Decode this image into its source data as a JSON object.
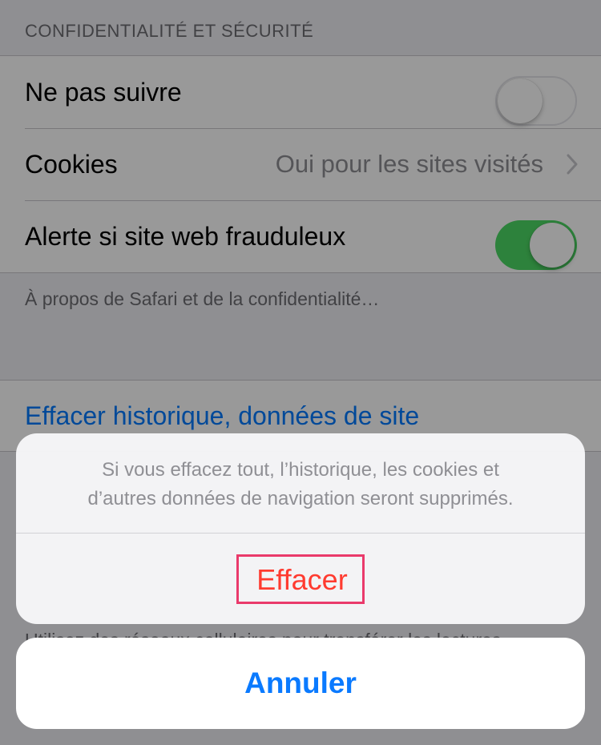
{
  "section": {
    "header": "CONFIDENTIALITÉ ET SÉCURITÉ"
  },
  "privacy_cells": [
    {
      "label": "Ne pas suivre",
      "control": "switch",
      "state": "off"
    },
    {
      "label": "Cookies",
      "value": "Oui pour les sites visités",
      "control": "chevron"
    },
    {
      "label": "Alerte si site web frauduleux",
      "control": "switch",
      "state": "on"
    }
  ],
  "footer_note": "À propos de Safari et de la confidentialité…",
  "clear_history": {
    "label": "Effacer historique, données de site"
  },
  "background_footer_text": "Utilisez des réseaux cellulaires pour transférer les lectures",
  "action_sheet": {
    "message_line1": "Si vous effacez tout, l’historique, les cookies et",
    "message_line2": "d’autres données de navigation seront supprimés.",
    "destructive_label": "Effacer",
    "cancel_label": "Annuler"
  },
  "colors": {
    "switch_on": "#4cd964",
    "link": "#007aff",
    "destructive": "#ff3b30",
    "highlight_box": "#ea3a6b"
  },
  "icons": {
    "chevron": "chevron-right-icon"
  }
}
